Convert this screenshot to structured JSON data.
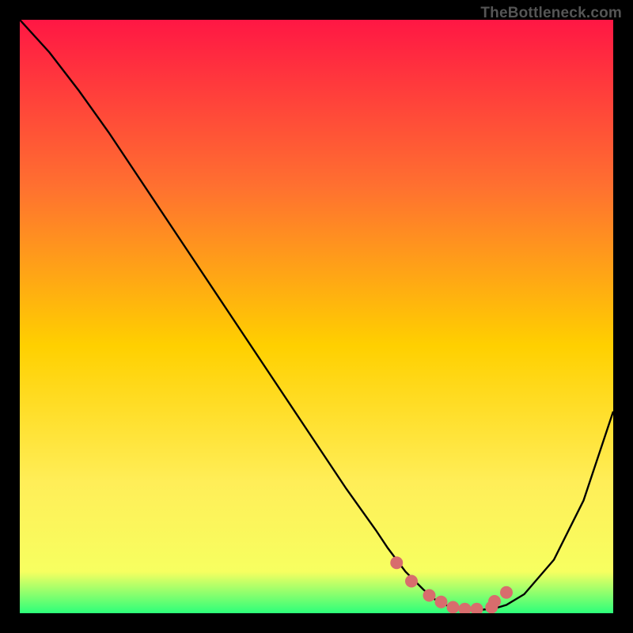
{
  "watermark": "TheBottleneck.com",
  "chart_data": {
    "type": "line",
    "title": "",
    "xlabel": "",
    "ylabel": "",
    "xlim": [
      0,
      100
    ],
    "ylim": [
      0,
      100
    ],
    "series": [
      {
        "name": "curve",
        "x": [
          0,
          5,
          10,
          15,
          20,
          25,
          30,
          35,
          40,
          45,
          50,
          55,
          60,
          62,
          65,
          68,
          70,
          72,
          74,
          76,
          78,
          80,
          82,
          85,
          90,
          95,
          100
        ],
        "y": [
          100,
          94.5,
          88,
          81,
          73.5,
          66,
          58.5,
          51,
          43.5,
          36,
          28.5,
          21,
          14,
          11,
          7,
          4,
          2.3,
          1.3,
          0.8,
          0.6,
          0.6,
          0.8,
          1.4,
          3.2,
          9,
          19,
          34
        ]
      }
    ],
    "markers": {
      "color": "#d86d6d",
      "x": [
        63.5,
        66,
        69,
        71,
        73,
        75,
        77,
        79.5,
        80,
        82
      ],
      "y": [
        8.5,
        5.4,
        3.0,
        1.9,
        1.0,
        0.7,
        0.7,
        1.0,
        2.0,
        3.5
      ]
    },
    "gradient_top": "#ff1744",
    "gradient_mid_upper": "#ff7030",
    "gradient_mid": "#ffd000",
    "gradient_mid_lower": "#ffee58",
    "gradient_low": "#f7ff60",
    "gradient_bottom": "#2cff7a",
    "curve_color": "#000000",
    "curve_width": 2.4,
    "marker_radius": 8
  }
}
